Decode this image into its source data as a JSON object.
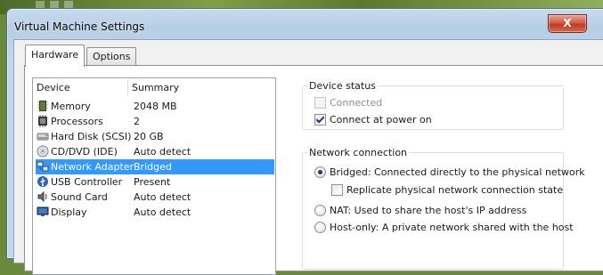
{
  "window": {
    "title": "Virtual Machine Settings",
    "close_glyph": "X"
  },
  "tabs": [
    {
      "label": "Hardware",
      "active": true
    },
    {
      "label": "Options",
      "active": false
    }
  ],
  "device_list": {
    "columns": {
      "device": "Device",
      "summary": "Summary"
    },
    "rows": [
      {
        "name": "Memory",
        "summary": "2048 MB",
        "icon": "memory-icon"
      },
      {
        "name": "Processors",
        "summary": "2",
        "icon": "processor-icon"
      },
      {
        "name": "Hard Disk (SCSI)",
        "summary": "20 GB",
        "icon": "hard-disk-icon"
      },
      {
        "name": "CD/DVD (IDE)",
        "summary": "Auto detect",
        "icon": "cd-dvd-icon"
      },
      {
        "name": "Network Adapter",
        "summary": "Bridged",
        "icon": "network-adapter-icon",
        "selected": true
      },
      {
        "name": "USB Controller",
        "summary": "Present",
        "icon": "usb-icon"
      },
      {
        "name": "Sound Card",
        "summary": "Auto detect",
        "icon": "sound-card-icon"
      },
      {
        "name": "Display",
        "summary": "Auto detect",
        "icon": "display-icon"
      }
    ]
  },
  "device_status": {
    "title": "Device status",
    "connected": {
      "label": "Connected",
      "checked": false,
      "enabled": false
    },
    "connect_at_power_on": {
      "label": "Connect at power on",
      "checked": true,
      "enabled": true
    }
  },
  "network_connection": {
    "title": "Network connection",
    "bridged": {
      "label": "Bridged: Connected directly to the physical network",
      "selected": true
    },
    "replicate": {
      "label": "Replicate physical network connection state",
      "checked": false
    },
    "nat": {
      "label": "NAT: Used to share the host's IP address",
      "selected": false
    },
    "host_only": {
      "label": "Host-only: A private network shared with the host",
      "selected": false
    }
  },
  "colors": {
    "selection": "#3399ff",
    "close_button": "#c23b22",
    "title_glass": "#b6cde6"
  }
}
